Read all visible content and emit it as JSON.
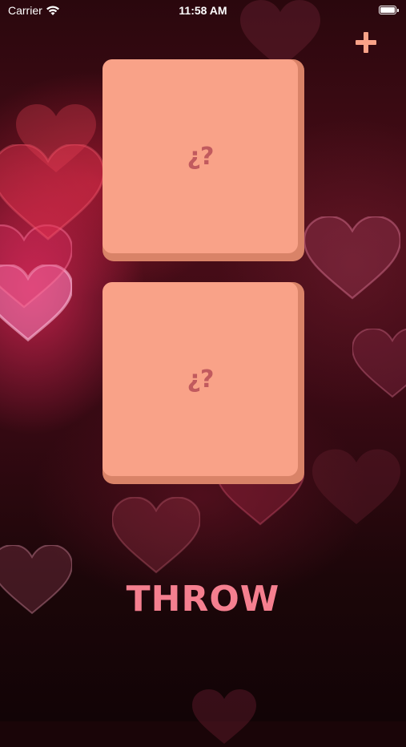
{
  "status_bar": {
    "carrier": "Carrier",
    "time": "11:58 AM"
  },
  "toolbar": {
    "add_icon": "plus-icon"
  },
  "dice": [
    {
      "face": "¿?"
    },
    {
      "face": "¿?"
    }
  ],
  "throw_button": {
    "label": "THROW"
  },
  "colors": {
    "die_face": "#f9a288",
    "die_shadow": "#d98368",
    "die_text": "#c15a5e",
    "throw_label": "#f57f8f",
    "add_icon": "#f9a288"
  }
}
